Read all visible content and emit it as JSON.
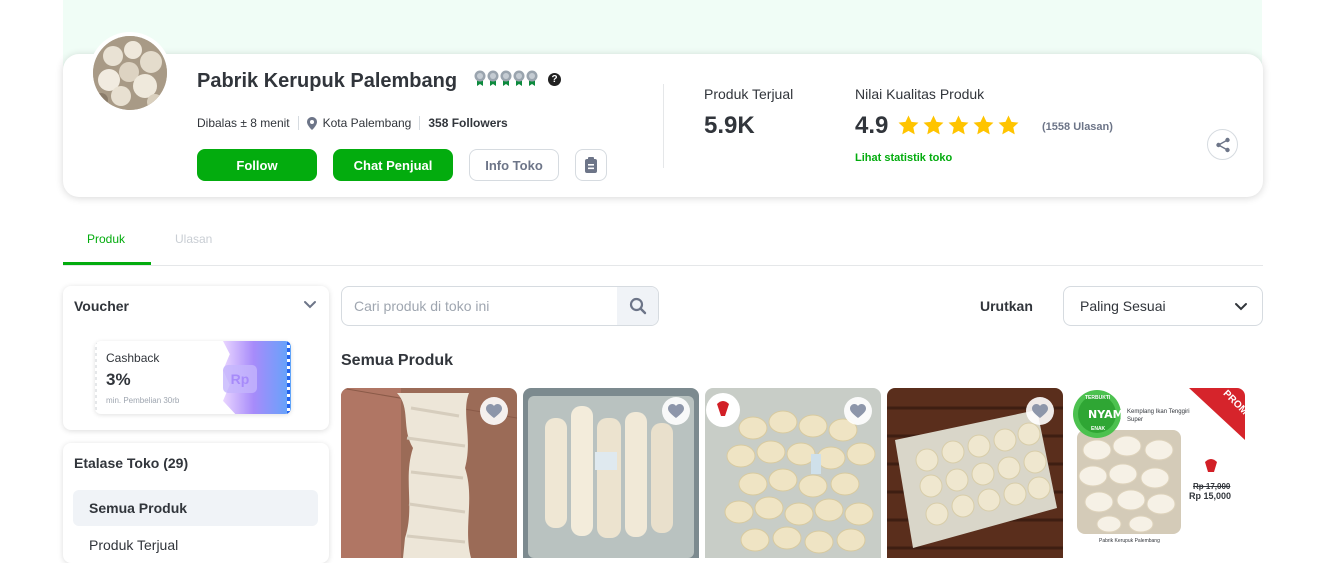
{
  "shop": {
    "name": "Pabrik Kerupuk Palembang",
    "response_time": "Dibalas ± 8 menit",
    "location": "Kota Palembang",
    "followers": "358 Followers"
  },
  "actions": {
    "follow": "Follow",
    "chat": "Chat Penjual",
    "info": "Info Toko"
  },
  "stats": {
    "sold_label": "Produk Terjual",
    "sold_value": "5.9K",
    "quality_label": "Nilai Kualitas Produk",
    "rating": "4.9",
    "reviews": "(1558 Ulasan)",
    "stat_link": "Lihat statistik toko"
  },
  "tabs": [
    {
      "label": "Produk",
      "active": true
    },
    {
      "label": "Ulasan",
      "active": false
    }
  ],
  "voucher": {
    "title": "Voucher",
    "type": "Cashback",
    "value": "3%",
    "min": "min. Pembelian 30rb",
    "icon_text": "Rp"
  },
  "etalase": {
    "title": "Etalase Toko (29)",
    "items": [
      "Semua Produk",
      "Produk Terjual"
    ]
  },
  "search": {
    "placeholder": "Cari produk di toko ini"
  },
  "sort": {
    "label": "Urutkan",
    "value": "Paling Sesuai"
  },
  "products_section": {
    "title": "Semua Produk"
  },
  "product_overlay": {
    "promo_tag": "PROMO",
    "badge": "NYAM!",
    "badge_top": "TERBUKTI",
    "badge_bottom": "ENAK",
    "name": "Kemplang Ikan Tenggiri Super",
    "old_price": "Rp 17,000",
    "new_price": "Rp 15,000",
    "footer": "Pabrik Kerupuk Palembang"
  },
  "colors": {
    "primary": "#03ac0e",
    "banner": "#f0fdf6",
    "star": "#ffc400",
    "text": "#31353b",
    "muted": "#6d7588"
  }
}
